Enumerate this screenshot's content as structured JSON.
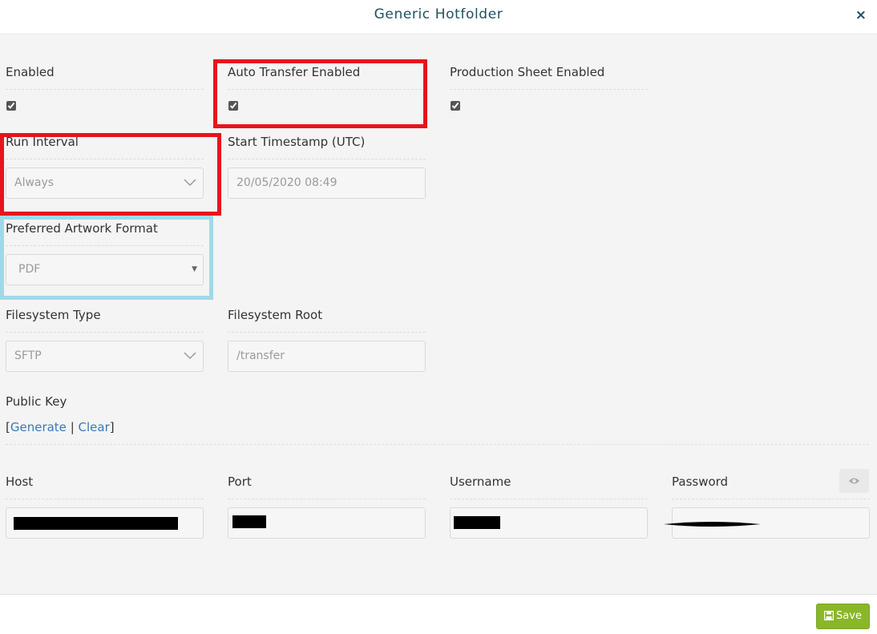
{
  "dialog": {
    "title": "Generic Hotfolder",
    "close_icon": "×"
  },
  "fields": {
    "enabled": {
      "label": "Enabled",
      "checked": true
    },
    "auto_transfer": {
      "label": "Auto Transfer Enabled",
      "checked": true
    },
    "production_sheet": {
      "label": "Production Sheet Enabled",
      "checked": true
    },
    "run_interval": {
      "label": "Run Interval",
      "value": "Always"
    },
    "start_timestamp": {
      "label": "Start Timestamp (UTC)",
      "value": "20/05/2020 08:49"
    },
    "artwork_format": {
      "label": "Preferred Artwork Format",
      "value": "PDF"
    },
    "filesystem_type": {
      "label": "Filesystem Type",
      "value": "SFTP"
    },
    "filesystem_root": {
      "label": "Filesystem Root",
      "value": "/transfer"
    },
    "public_key": {
      "label": "Public Key",
      "open_bracket": "[",
      "generate": "Generate",
      "separator": " | ",
      "clear": "Clear",
      "close_bracket": "]"
    },
    "host": {
      "label": "Host"
    },
    "port": {
      "label": "Port"
    },
    "username": {
      "label": "Username"
    },
    "password": {
      "label": "Password",
      "toggle_icon": "eye-icon"
    }
  },
  "footer": {
    "save_label": "Save"
  },
  "annotations": {
    "red": "#e8141c",
    "blue": "#9fd9e8"
  },
  "colors": {
    "accent": "#8ab62a",
    "link": "#3a78b5",
    "title": "#1f5060"
  }
}
